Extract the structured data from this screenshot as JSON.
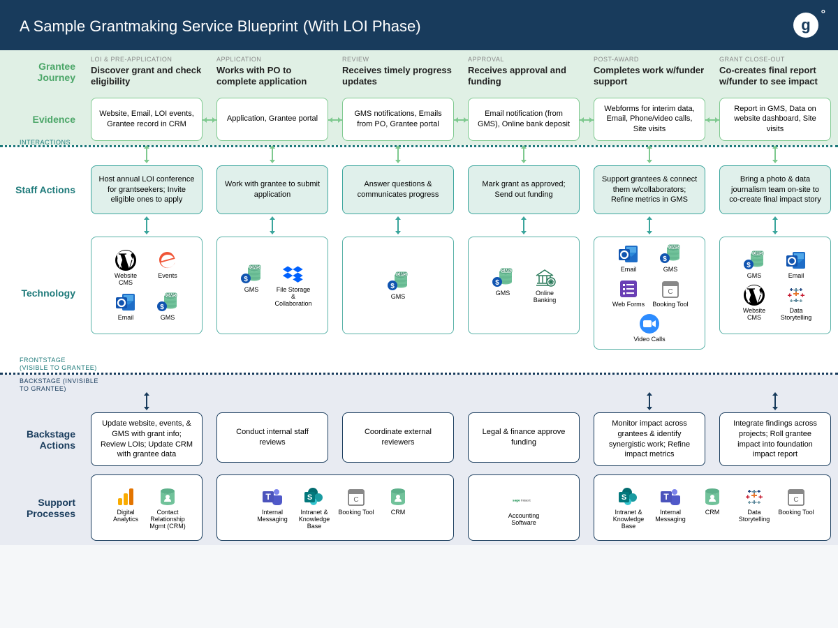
{
  "header": {
    "title": "A Sample Grantmaking Service Blueprint",
    "subtitle": "(With LOI Phase)"
  },
  "rows": {
    "journey": "Grantee Journey",
    "evidence": "Evidence",
    "staff": "Staff Actions",
    "tech": "Technology",
    "backstage": "Backstage Actions",
    "support": "Support Processes"
  },
  "lanes": {
    "interactions": "INTERACTIONS",
    "frontstage": "FRONTSTAGE\n(VISIBLE TO GRANTEE)",
    "backstage": "BACKSTAGE (INVISIBLE\nTO GRANTEE)"
  },
  "phases": [
    {
      "label": "LOI & PRE-APPLICATION",
      "title": "Discover grant and check eligibility"
    },
    {
      "label": "APPLICATION",
      "title": "Works with PO to complete application"
    },
    {
      "label": "REVIEW",
      "title": "Receives timely progress updates"
    },
    {
      "label": "APPROVAL",
      "title": "Receives approval and funding"
    },
    {
      "label": "POST-AWARD",
      "title": "Completes work w/funder support"
    },
    {
      "label": "GRANT CLOSE-OUT",
      "title": "Co-creates final report w/funder to see impact"
    }
  ],
  "evidence": [
    "Website, Email, LOI events, Grantee record in CRM",
    "Application, Grantee portal",
    "GMS notifications, Emails from PO, Grantee portal",
    "Email notification (from GMS), Online bank deposit",
    "Webforms for interim data, Email, Phone/video calls, Site visits",
    "Report in GMS, Data on website dashboard, Site visits"
  ],
  "staff": [
    "Host annual LOI conference for grantseekers; Invite eligible ones to apply",
    "Work with grantee to submit application",
    "Answer questions & communicates progress",
    "Mark grant as approved; Send out funding",
    "Support grantees & connect them w/collaborators; Refine metrics in GMS",
    "Bring a photo & data journalism team on-site to co-create final impact story"
  ],
  "tech": [
    [
      {
        "ico": "wordpress",
        "label": "Website CMS"
      },
      {
        "ico": "eventbrite",
        "label": "Events"
      },
      {
        "ico": "outlook",
        "label": "Email"
      },
      {
        "ico": "gms",
        "label": "GMS"
      }
    ],
    [
      {
        "ico": "gms",
        "label": "GMS"
      },
      {
        "ico": "dropbox",
        "label": "File Storage & Collaboration"
      }
    ],
    [
      {
        "ico": "gms",
        "label": "GMS"
      }
    ],
    [
      {
        "ico": "gms",
        "label": "GMS"
      },
      {
        "ico": "bank",
        "label": "Online Banking"
      }
    ],
    [
      {
        "ico": "outlook",
        "label": "Email"
      },
      {
        "ico": "gms",
        "label": "GMS"
      },
      {
        "ico": "forms",
        "label": "Web Forms"
      },
      {
        "ico": "calendar",
        "label": "Booking Tool"
      },
      {
        "ico": "zoom",
        "label": "Video Calls"
      }
    ],
    [
      {
        "ico": "gms",
        "label": "GMS"
      },
      {
        "ico": "outlook",
        "label": "Email"
      },
      {
        "ico": "wordpress",
        "label": "Website CMS"
      },
      {
        "ico": "tableau",
        "label": "Data Storytelling"
      }
    ]
  ],
  "backstage": [
    "Update website, events, & GMS with grant info; Review LOIs; Update CRM with grantee data",
    "Conduct internal staff reviews",
    "Coordinate external reviewers",
    "Legal & finance approve funding",
    "Monitor impact across grantees & identify synergistic work; Refine impact metrics",
    "Integrate findings across projects; Roll grantee impact into foundation impact report"
  ],
  "support": [
    {
      "span": 1,
      "items": [
        {
          "ico": "analytics",
          "label": "Digital Analytics"
        },
        {
          "ico": "crm",
          "label": "Contact Relationship Mgmt (CRM)"
        }
      ]
    },
    {
      "span": 2,
      "items": [
        {
          "ico": "teams",
          "label": "Internal Messaging"
        },
        {
          "ico": "sharepoint",
          "label": "Intranet & Knowledge Base"
        },
        {
          "ico": "calendar",
          "label": "Booking Tool"
        },
        {
          "ico": "crm",
          "label": "CRM"
        }
      ]
    },
    {
      "span": 1,
      "items": [
        {
          "ico": "sage",
          "label": "Accounting Software"
        }
      ]
    },
    {
      "span": 2,
      "items": [
        {
          "ico": "sharepoint",
          "label": "Intranet & Knowledge Base"
        },
        {
          "ico": "teams",
          "label": "Internal Messaging"
        },
        {
          "ico": "crm",
          "label": "CRM"
        },
        {
          "ico": "tableau",
          "label": "Data Storytelling"
        },
        {
          "ico": "calendar",
          "label": "Booking Tool"
        }
      ]
    }
  ]
}
